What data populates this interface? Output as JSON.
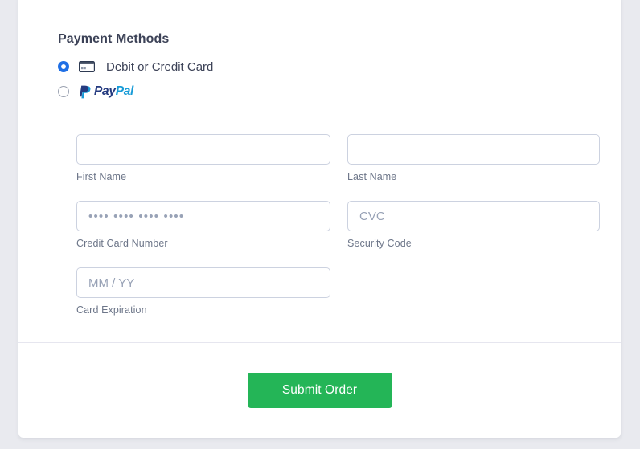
{
  "payment": {
    "section_title": "Payment Methods",
    "methods": [
      {
        "id": "card",
        "label": "Debit or Credit Card",
        "icon": "credit-card-icon",
        "selected": true
      },
      {
        "id": "paypal",
        "label": "PayPal",
        "logo_part_1": "Pay",
        "logo_part_2": "Pal",
        "icon": "paypal-icon",
        "selected": false
      }
    ]
  },
  "form": {
    "fields": [
      {
        "name": "first-name",
        "value": "",
        "placeholder": "",
        "label": "First Name"
      },
      {
        "name": "last-name",
        "value": "",
        "placeholder": "",
        "label": "Last Name"
      },
      {
        "name": "credit-card-number",
        "value": "",
        "placeholder": "•••• •••• •••• ••••",
        "label": "Credit Card Number"
      },
      {
        "name": "security-code",
        "value": "",
        "placeholder": "CVC",
        "label": "Security Code"
      },
      {
        "name": "card-expiration",
        "value": "",
        "placeholder": "MM / YY",
        "label": "Card Expiration"
      }
    ]
  },
  "footer": {
    "submit_label": "Submit Order"
  },
  "colors": {
    "submit_green": "#24b557",
    "radio_blue": "#1f6fe5",
    "paypal_dark": "#253b80",
    "paypal_light": "#179bd7",
    "text_dark": "#3c4257",
    "label_gray": "#6d7689",
    "page_background": "#e9eaef"
  }
}
